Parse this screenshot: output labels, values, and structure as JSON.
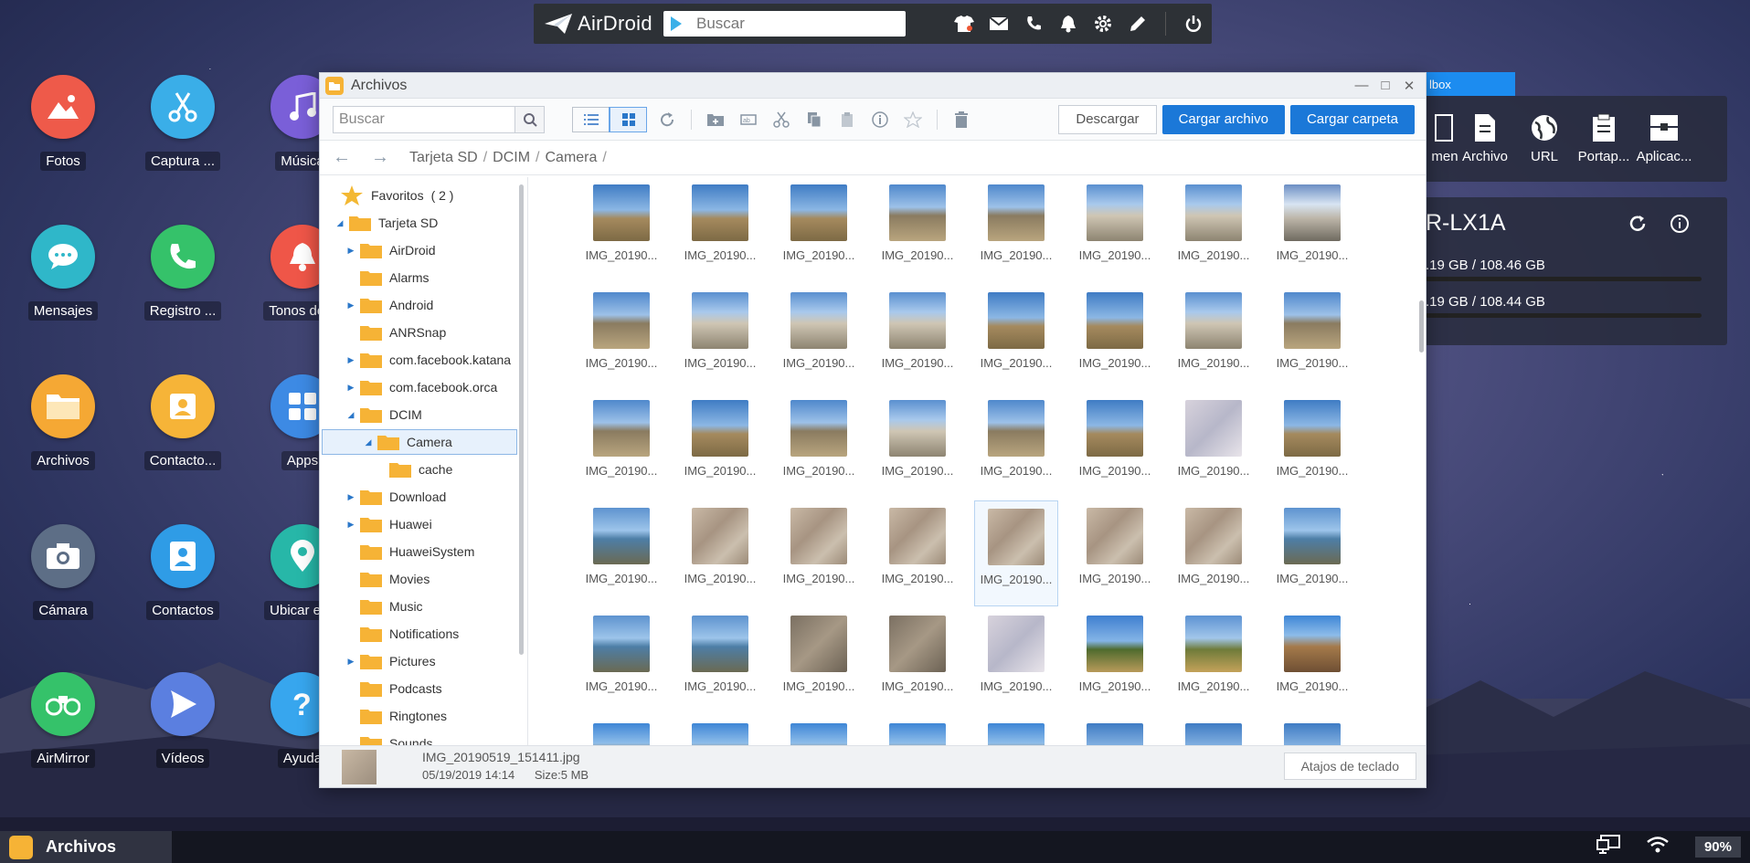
{
  "topbar": {
    "logo": "AirDroid",
    "search_placeholder": "Buscar",
    "icons": [
      "tshirt-icon",
      "mail-icon",
      "phone-icon",
      "bell-icon",
      "gear-icon",
      "edit-icon",
      "power-icon"
    ]
  },
  "desktop_apps": [
    {
      "label": "Fotos",
      "color": "#ee5a4a",
      "icon": "photos-icon"
    },
    {
      "label": "Captura ...",
      "color": "#3aaee8",
      "icon": "scissors-icon"
    },
    {
      "label": "Música",
      "color": "#7a5fd8",
      "icon": "music-icon"
    },
    {
      "label": "Mensajes",
      "color": "#2fb7c9",
      "icon": "chat-icon"
    },
    {
      "label": "Registro ...",
      "color": "#35c26a",
      "icon": "call-log-icon"
    },
    {
      "label": "Tonos de...",
      "color": "#ef5648",
      "icon": "ringtone-icon"
    },
    {
      "label": "Archivos",
      "color": "#f5a834",
      "icon": "folder-icon"
    },
    {
      "label": "Contacto...",
      "color": "#f6b438",
      "icon": "contacts-card-icon"
    },
    {
      "label": "Apps",
      "color": "#3d8ae4",
      "icon": "apps-icon"
    },
    {
      "label": "Cámara",
      "color": "#5d6e86",
      "icon": "camera-icon"
    },
    {
      "label": "Contactos",
      "color": "#2f9ce6",
      "icon": "contact-icon"
    },
    {
      "label": "Ubicar el...",
      "color": "#27b7a8",
      "icon": "location-icon"
    },
    {
      "label": "AirMirror",
      "color": "#35c26a",
      "icon": "binoculars-icon"
    },
    {
      "label": "Vídeos",
      "color": "#5b7fe0",
      "icon": "video-icon"
    },
    {
      "label": "Ayuda",
      "color": "#37a6ee",
      "icon": "help-icon"
    }
  ],
  "toolbox": {
    "title": "lbox",
    "items": [
      "men",
      "Archivo",
      "URL",
      "Portap...",
      "Aplicac..."
    ]
  },
  "device": {
    "name": "R-LX1A",
    "storage1": ".19 GB / 108.46 GB",
    "storage2": ".19 GB / 108.44 GB"
  },
  "window": {
    "title": "Archivos",
    "search_placeholder": "Buscar",
    "btn_download": "Descargar",
    "btn_upload_file": "Cargar archivo",
    "btn_upload_folder": "Cargar carpeta",
    "breadcrumb": [
      "Tarjeta SD",
      "DCIM",
      "Camera"
    ],
    "tree": {
      "favorites": "Favoritos",
      "favorites_count": "( 2 )",
      "root": "Tarjeta SD",
      "items": [
        {
          "label": "AirDroid",
          "expandable": true,
          "level": 1
        },
        {
          "label": "Alarms",
          "expandable": false,
          "level": 1
        },
        {
          "label": "Android",
          "expandable": true,
          "level": 1
        },
        {
          "label": "ANRSnap",
          "expandable": false,
          "level": 1
        },
        {
          "label": "com.facebook.katana",
          "expandable": true,
          "level": 1
        },
        {
          "label": "com.facebook.orca",
          "expandable": true,
          "level": 1
        },
        {
          "label": "DCIM",
          "expandable": true,
          "level": 1,
          "open": true
        },
        {
          "label": "Camera",
          "expandable": true,
          "level": 2,
          "open": true,
          "selected": true
        },
        {
          "label": "cache",
          "expandable": false,
          "level": 3
        },
        {
          "label": "Download",
          "expandable": true,
          "level": 1
        },
        {
          "label": "Huawei",
          "expandable": true,
          "level": 1
        },
        {
          "label": "HuaweiSystem",
          "expandable": false,
          "level": 1
        },
        {
          "label": "Movies",
          "expandable": false,
          "level": 1
        },
        {
          "label": "Music",
          "expandable": false,
          "level": 1
        },
        {
          "label": "Notifications",
          "expandable": false,
          "level": 1
        },
        {
          "label": "Pictures",
          "expandable": true,
          "level": 1
        },
        {
          "label": "Podcasts",
          "expandable": false,
          "level": 1
        },
        {
          "label": "Ringtones",
          "expandable": false,
          "level": 1
        },
        {
          "label": "Sounds",
          "expandable": false,
          "level": 1
        }
      ]
    },
    "file_caption": "IMG_20190...",
    "thumbs": [
      [
        "sky",
        "sky",
        "sky",
        "ruin",
        "ruin",
        "town",
        "town",
        "cloud"
      ],
      [
        "ruin",
        "town",
        "town",
        "town",
        "sky",
        "sky",
        "town",
        "ruin"
      ],
      [
        "ruin",
        "sky",
        "ruin",
        "town",
        "ruin",
        "sky",
        "doc",
        "sky"
      ],
      [
        "sea",
        "mosaic",
        "mosaic",
        "mosaic",
        "mosaic",
        "mosaic",
        "mosaic",
        "sea"
      ],
      [
        "sea",
        "sea",
        "rock",
        "rock",
        "doc",
        "tree",
        "field",
        "church"
      ],
      [
        "church",
        "church",
        "church",
        "church",
        "church",
        "sky",
        "sky",
        "sky"
      ]
    ],
    "selected_cell": [
      3,
      4
    ],
    "status": {
      "filename": "IMG_20190519_151411.jpg",
      "date": "05/19/2019 14:14",
      "size": "Size:5 MB",
      "shortcuts": "Atajos de teclado"
    }
  },
  "taskbar": {
    "active_app": "Archivos",
    "battery": "90%"
  },
  "colors": {
    "accent": "#1b78d8",
    "folder": "#f6b336"
  }
}
